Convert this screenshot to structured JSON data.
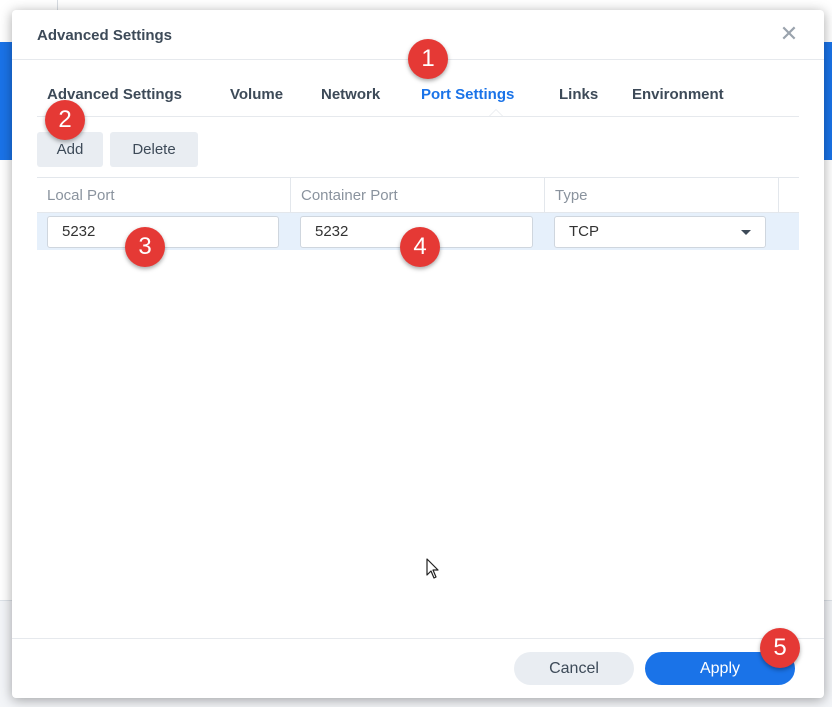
{
  "dialog": {
    "title": "Advanced Settings",
    "close_glyph": "✕"
  },
  "tabs": [
    {
      "label": "Advanced Settings",
      "active": false
    },
    {
      "label": "Volume",
      "active": false
    },
    {
      "label": "Network",
      "active": false
    },
    {
      "label": "Port Settings",
      "active": true
    },
    {
      "label": "Links",
      "active": false
    },
    {
      "label": "Environment",
      "active": false
    }
  ],
  "toolbar": {
    "add_label": "Add",
    "delete_label": "Delete"
  },
  "grid": {
    "columns": [
      "Local Port",
      "Container Port",
      "Type"
    ],
    "rows": [
      {
        "local_port": "5232",
        "container_port": "5232",
        "type": "TCP"
      }
    ]
  },
  "footer": {
    "cancel_label": "Cancel",
    "apply_label": "Apply"
  },
  "markers": [
    "1",
    "2",
    "3",
    "4",
    "5"
  ],
  "colors": {
    "accent": "#1a73e8",
    "marker": "#e53935"
  }
}
